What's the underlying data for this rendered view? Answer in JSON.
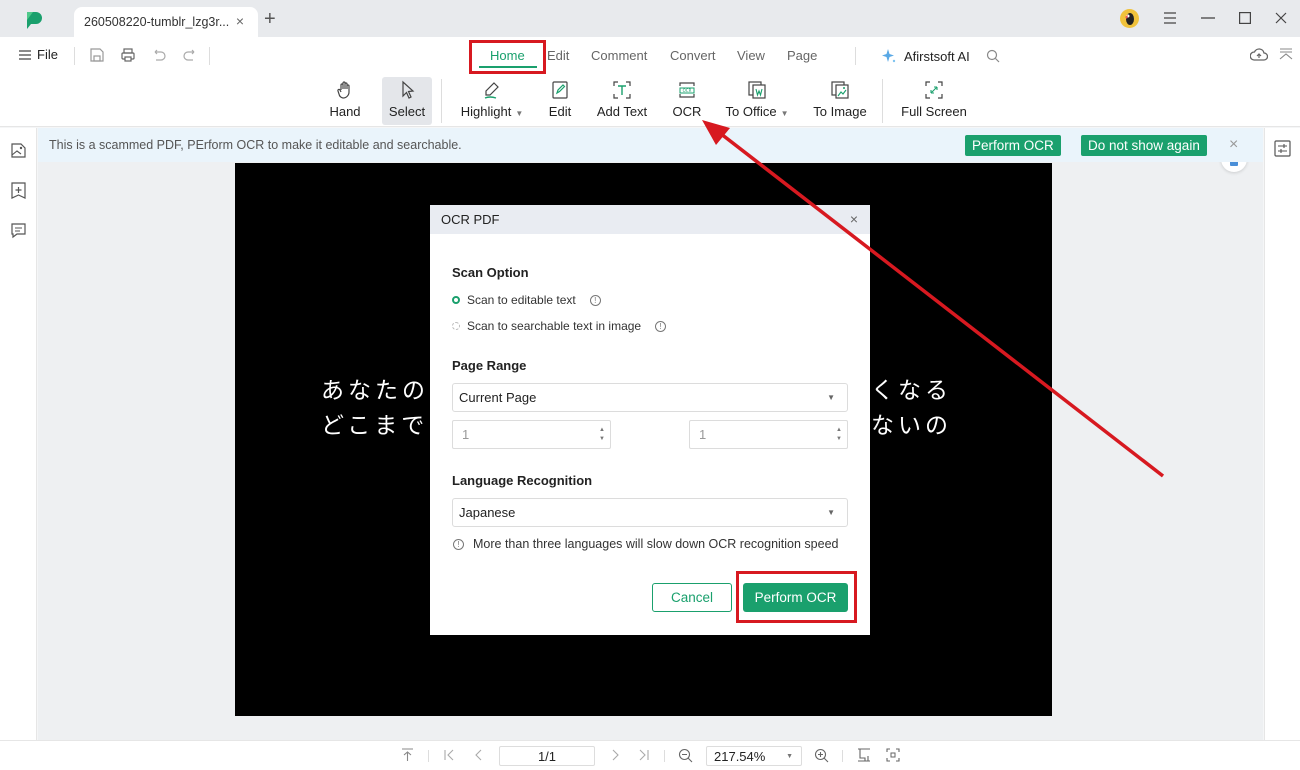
{
  "titlebar": {
    "tab_title": "260508220-tumblr_lzg3r...",
    "tab_close": "×",
    "new_tab": "+"
  },
  "menubar": {
    "file_label": "File",
    "tabs": [
      {
        "label": "Home",
        "active": true
      },
      {
        "label": "Edit"
      },
      {
        "label": "Comment"
      },
      {
        "label": "Convert"
      },
      {
        "label": "View"
      },
      {
        "label": "Page"
      }
    ],
    "ai_label": "Afirstsoft AI"
  },
  "ribbon": {
    "tools": [
      {
        "label": "Hand",
        "icon": "hand-icon"
      },
      {
        "label": "Select",
        "icon": "cursor-icon",
        "selected": true
      },
      {
        "label": "Highlight",
        "icon": "highlight-pen-icon",
        "dropdown": true
      },
      {
        "label": "Edit",
        "icon": "edit-icon"
      },
      {
        "label": "Add Text",
        "icon": "add-text-icon"
      },
      {
        "label": "OCR",
        "icon": "ocr-icon"
      },
      {
        "label": "To Office",
        "icon": "to-office-icon",
        "dropdown": true
      },
      {
        "label": "To Image",
        "icon": "to-image-icon"
      },
      {
        "label": "Full Screen",
        "icon": "full-screen-icon"
      }
    ]
  },
  "notice": {
    "text": "This is a scammed PDF, PErform OCR to make it editable and searchable.",
    "perform_label": "Perform OCR",
    "dismiss_label": "Do not show again",
    "close": "×"
  },
  "document": {
    "line1_left": "あなたの",
    "line1_right": "くなる",
    "line2_left": "どこまで",
    "line2_right": "ないの"
  },
  "dialog": {
    "title": "OCR PDF",
    "close": "×",
    "scan_option_title": "Scan Option",
    "scan_options": [
      {
        "label": "Scan to editable text",
        "selected": true
      },
      {
        "label": "Scan to searchable text in image",
        "selected": false
      }
    ],
    "page_range_title": "Page Range",
    "page_range_value": "Current Page",
    "range_from": "1",
    "range_to": "1",
    "language_title": "Language Recognition",
    "language_value": "Japanese",
    "hint": "More than three languages will slow down OCR recognition speed",
    "cancel_label": "Cancel",
    "perform_label": "Perform OCR"
  },
  "bottombar": {
    "page_indicator": "1/1",
    "zoom_level": "217.54%"
  },
  "colors": {
    "accent": "#1aa06d",
    "annotation": "#d71920",
    "notice_bg": "#eaf4fb"
  }
}
